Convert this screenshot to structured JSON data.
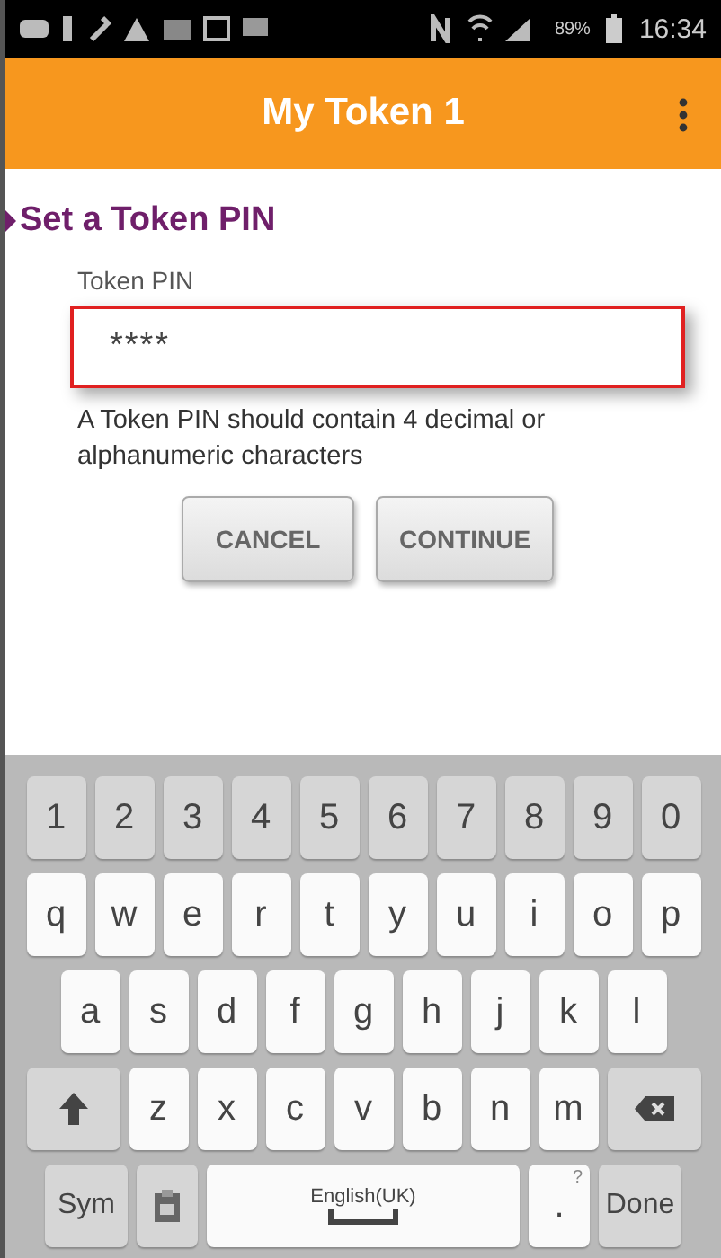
{
  "status_bar": {
    "battery": "89%",
    "time": "16:34"
  },
  "app_bar": {
    "title": "My Token 1"
  },
  "section": {
    "title": "Set a Token PIN"
  },
  "pin_field": {
    "label": "Token PIN",
    "value": "****",
    "hint": "A Token PIN should contain 4 decimal or alphanumeric characters"
  },
  "buttons": [
    {
      "label": "CANCEL"
    },
    {
      "label": "CONTINUE"
    }
  ],
  "keyboard": {
    "rows": [
      [
        {
          "kind": "num",
          "label": "1"
        },
        {
          "kind": "num",
          "label": "2"
        },
        {
          "kind": "num",
          "label": "3"
        },
        {
          "kind": "num",
          "label": "4"
        },
        {
          "kind": "num",
          "label": "5"
        },
        {
          "kind": "num",
          "label": "6"
        },
        {
          "kind": "num",
          "label": "7"
        },
        {
          "kind": "num",
          "label": "8"
        },
        {
          "kind": "num",
          "label": "9"
        },
        {
          "kind": "num",
          "label": "0"
        }
      ],
      [
        {
          "kind": "char",
          "label": "q"
        },
        {
          "kind": "char",
          "label": "w"
        },
        {
          "kind": "char",
          "label": "e"
        },
        {
          "kind": "char",
          "label": "r"
        },
        {
          "kind": "char",
          "label": "t"
        },
        {
          "kind": "char",
          "label": "y"
        },
        {
          "kind": "char",
          "label": "u"
        },
        {
          "kind": "char",
          "label": "i"
        },
        {
          "kind": "char",
          "label": "o"
        },
        {
          "kind": "char",
          "label": "p"
        }
      ],
      [
        {
          "kind": "char",
          "label": "a"
        },
        {
          "kind": "char",
          "label": "s"
        },
        {
          "kind": "char",
          "label": "d"
        },
        {
          "kind": "char",
          "label": "f"
        },
        {
          "kind": "char",
          "label": "g"
        },
        {
          "kind": "char",
          "label": "h"
        },
        {
          "kind": "char",
          "label": "j"
        },
        {
          "kind": "char",
          "label": "k"
        },
        {
          "kind": "char",
          "label": "l"
        }
      ],
      [
        {
          "kind": "shift"
        },
        {
          "kind": "char",
          "label": "z"
        },
        {
          "kind": "char",
          "label": "x"
        },
        {
          "kind": "char",
          "label": "c"
        },
        {
          "kind": "char",
          "label": "v"
        },
        {
          "kind": "char",
          "label": "b"
        },
        {
          "kind": "char",
          "label": "n"
        },
        {
          "kind": "char",
          "label": "m"
        },
        {
          "kind": "backspace"
        }
      ]
    ],
    "bottom_bar": {
      "sym_key": "Sym",
      "space_key": "English(UK)",
      "period_key": ".",
      "period_hint": "?",
      "done_key": "Done"
    }
  }
}
